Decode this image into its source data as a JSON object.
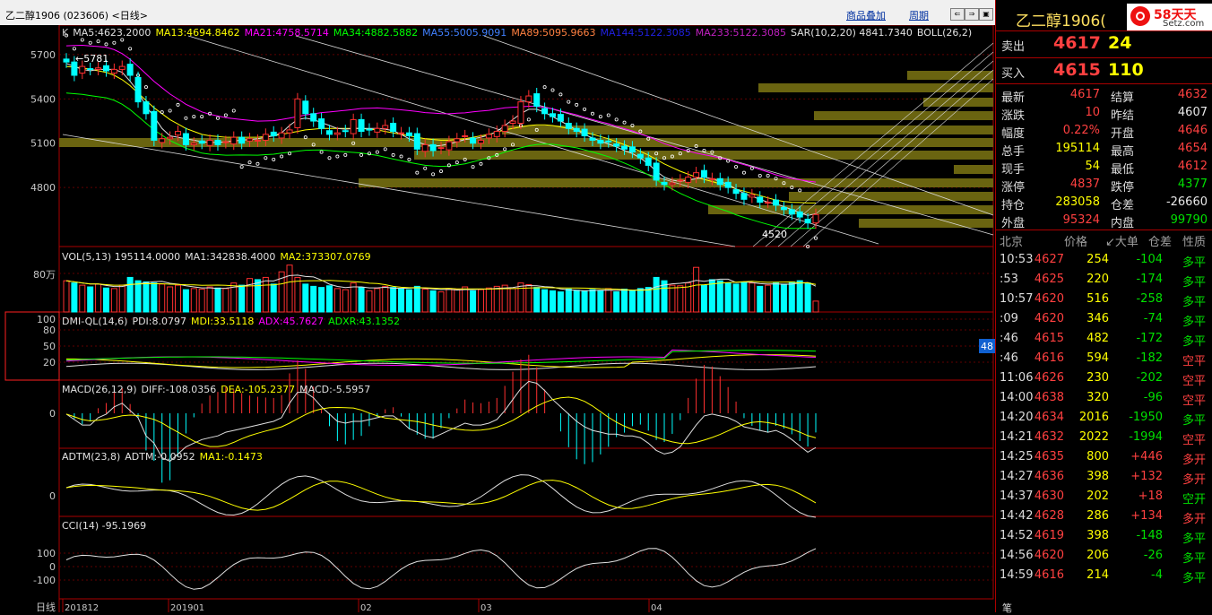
{
  "topbar": {
    "title": "乙二醇1906 (023606) <日线>",
    "overlay_link": "商品叠加",
    "period_link": "周期"
  },
  "k_panel": {
    "indicators": [
      {
        "text": "K",
        "color": "#c8c8c8"
      },
      {
        "text": "MA5:4623.2000",
        "color": "#e0e0e0"
      },
      {
        "text": "MA13:4694.8462",
        "color": "#ffff00"
      },
      {
        "text": "MA21:4758.5714",
        "color": "#ff00ff"
      },
      {
        "text": "MA34:4882.5882",
        "color": "#00ff00"
      },
      {
        "text": "MA55:5005.9091",
        "color": "#4080ff"
      },
      {
        "text": "MA89:5095.9663",
        "color": "#ff8040"
      },
      {
        "text": "MA144:5122.3085",
        "color": "#2020e0"
      },
      {
        "text": "MA233:5122.3085",
        "color": "#c020c0"
      },
      {
        "text": "SAR(10,2,20)  4841.7340",
        "color": "#e0e0e0"
      },
      {
        "text": "BOLL(26,2)",
        "color": "#e0e0e0"
      }
    ],
    "axis_labels": [
      "5700",
      "5400",
      "5100",
      "4800"
    ],
    "high_mark": "5781",
    "low_mark": "4520"
  },
  "vol_panel": {
    "indicators": [
      {
        "text": "VOL(5,13)  195114.0000",
        "color": "#e0e0e0"
      },
      {
        "text": "MA1:342838.4000",
        "color": "#e0e0e0"
      },
      {
        "text": "MA2:373307.0769",
        "color": "#ffff00"
      }
    ],
    "axis_label": "80万"
  },
  "dmi_panel": {
    "indicators": [
      {
        "text": "DMI-QL(14,6)",
        "color": "#e0e0e0"
      },
      {
        "text": "PDI:8.0797",
        "color": "#e0e0e0"
      },
      {
        "text": "MDI:33.5118",
        "color": "#ffff00"
      },
      {
        "text": "ADX:45.7627",
        "color": "#ff00ff"
      },
      {
        "text": "ADXR:43.1352",
        "color": "#00ff00"
      }
    ],
    "axis_labels": [
      "100",
      "80",
      "50",
      "20"
    ],
    "badge": "48"
  },
  "macd_panel": {
    "indicators": [
      {
        "text": "MACD(26,12,9)",
        "color": "#e0e0e0"
      },
      {
        "text": "DIFF:-108.0356",
        "color": "#e0e0e0"
      },
      {
        "text": "DEA:-105.2377",
        "color": "#ffff00"
      },
      {
        "text": "MACD:-5.5957",
        "color": "#e0e0e0"
      }
    ],
    "axis_label": "0"
  },
  "adtm_panel": {
    "indicators": [
      {
        "text": "ADTM(23,8)",
        "color": "#e0e0e0"
      },
      {
        "text": "ADTM:-0.0952",
        "color": "#e0e0e0"
      },
      {
        "text": "MA1:-0.1473",
        "color": "#ffff00"
      }
    ],
    "axis_label": "0"
  },
  "cci_panel": {
    "indicators": [
      {
        "text": "CCI(14)  -95.1969",
        "color": "#e0e0e0"
      }
    ],
    "axis_labels": [
      "100",
      "0",
      "-100"
    ]
  },
  "date_axis": {
    "period": "日线",
    "labels": [
      "201812",
      "201901",
      "02",
      "03",
      "04"
    ]
  },
  "chart_data": {
    "type": "candlestick",
    "xlabel": "",
    "ylabel": "",
    "ylim": [
      4400,
      5900
    ],
    "x_labels": [
      "201812",
      "201901",
      "02",
      "03",
      "04"
    ],
    "close": [
      5650,
      5560,
      5620,
      5600,
      5610,
      5590,
      5600,
      5620,
      5560,
      5380,
      5300,
      5120,
      5130,
      5140,
      5180,
      5090,
      5100,
      5100,
      5120,
      5090,
      5110,
      5140,
      5100,
      5130,
      5120,
      5160,
      5150,
      5170,
      5190,
      5400,
      5300,
      5250,
      5200,
      5160,
      5170,
      5180,
      5260,
      5180,
      5190,
      5200,
      5220,
      5180,
      5170,
      5150,
      5060,
      5090,
      5050,
      5070,
      5110,
      5130,
      5150,
      5100,
      5120,
      5160,
      5180,
      5220,
      5250,
      5380,
      5420,
      5350,
      5300,
      5280,
      5250,
      5200,
      5180,
      5150,
      5120,
      5100,
      5110,
      5080,
      5060,
      5040,
      5000,
      4950,
      4850,
      4820,
      4830,
      4850,
      4870,
      4900,
      4870,
      4860,
      4820,
      4800,
      4760,
      4720,
      4750,
      4700,
      4700,
      4680,
      4650,
      4620,
      4600,
      4560,
      4617
    ],
    "ma5": [
      5640,
      5620,
      5600,
      5590,
      5600,
      5600,
      5600,
      5580,
      5520,
      5450,
      5350,
      5280,
      5200,
      5150,
      5140,
      5130,
      5120,
      5110,
      5105,
      5105,
      5110,
      5115,
      5120,
      5125,
      5130,
      5140,
      5150,
      5170,
      5220,
      5260,
      5270,
      5260,
      5240,
      5220,
      5200,
      5195,
      5200,
      5200,
      5200,
      5200,
      5195,
      5185,
      5160,
      5130,
      5110,
      5090,
      5080,
      5085,
      5095,
      5110,
      5125,
      5130,
      5140,
      5155,
      5180,
      5220,
      5260,
      5300,
      5330,
      5330,
      5310,
      5280,
      5250,
      5220,
      5190,
      5160,
      5135,
      5115,
      5095,
      5075,
      5050,
      5030,
      5000,
      4960,
      4910,
      4870,
      4850,
      4840,
      4850,
      4860,
      4870,
      4860,
      4840,
      4820,
      4790,
      4760,
      4740,
      4720,
      4700,
      4690,
      4670,
      4650,
      4630,
      4610,
      4623
    ],
    "ma13": [
      5620,
      5615,
      5610,
      5600,
      5590,
      5580,
      5560,
      5530,
      5490,
      5440,
      5390,
      5340,
      5300,
      5260,
      5230,
      5200,
      5180,
      5160,
      5150,
      5145,
      5140,
      5140,
      5140,
      5140,
      5140,
      5145,
      5150,
      5160,
      5170,
      5180,
      5190,
      5195,
      5200,
      5200,
      5200,
      5200,
      5200,
      5200,
      5195,
      5190,
      5180,
      5170,
      5160,
      5150,
      5140,
      5130,
      5125,
      5120,
      5120,
      5125,
      5130,
      5140,
      5150,
      5160,
      5175,
      5190,
      5200,
      5210,
      5220,
      5225,
      5225,
      5220,
      5210,
      5200,
      5190,
      5175,
      5160,
      5145,
      5130,
      5110,
      5090,
      5070,
      5045,
      5020,
      4990,
      4960,
      4935,
      4910,
      4890,
      4870,
      4855,
      4840,
      4825,
      4810,
      4790,
      4775,
      4760,
      4745,
      4730,
      4715,
      4705,
      4700,
      4698,
      4695,
      4695
    ],
    "vol": [
      560,
      520,
      480,
      450,
      500,
      430,
      420,
      480,
      620,
      560,
      540,
      520,
      500,
      450,
      480,
      400,
      420,
      410,
      450,
      430,
      420,
      520,
      480,
      600,
      580,
      620,
      500,
      720,
      840,
      620,
      500,
      460,
      440,
      470,
      420,
      400,
      520,
      440,
      380,
      420,
      460,
      440,
      420,
      400,
      460,
      410,
      380,
      360,
      420,
      400,
      450,
      380,
      400,
      430,
      460,
      480,
      420,
      520,
      490,
      440,
      400,
      380,
      360,
      410,
      390,
      370,
      400,
      380,
      420,
      360,
      410,
      380,
      420,
      440,
      620,
      560,
      480,
      470,
      520,
      800,
      480,
      580,
      560,
      520,
      500,
      540,
      520,
      460,
      480,
      520,
      500,
      540,
      560,
      520,
      195
    ]
  },
  "right": {
    "symbol": "乙二醇1906(",
    "logo_main": "58天天",
    "logo_sub": "Setz.com",
    "sell": {
      "label": "卖出",
      "price": "4617",
      "vol": "24"
    },
    "buy": {
      "label": "买入",
      "price": "4615",
      "vol": "110"
    },
    "quotes": [
      {
        "l1": "最新",
        "v1": "4617",
        "c1": "red",
        "l2": "结算",
        "v2": "4632",
        "c2": "red"
      },
      {
        "l1": "涨跌",
        "v1": "10",
        "c1": "red",
        "l2": "昨结",
        "v2": "4607",
        "c2": "wht"
      },
      {
        "l1": "幅度",
        "v1": "0.22%",
        "c1": "red",
        "l2": "开盘",
        "v2": "4646",
        "c2": "red"
      },
      {
        "l1": "总手",
        "v1": "195114",
        "c1": "yel",
        "l2": "最高",
        "v2": "4654",
        "c2": "red"
      },
      {
        "l1": "现手",
        "v1": "54",
        "c1": "yel",
        "l2": "最低",
        "v2": "4612",
        "c2": "red"
      },
      {
        "l1": "涨停",
        "v1": "4837",
        "c1": "red",
        "l2": "跌停",
        "v2": "4377",
        "c2": "grn"
      },
      {
        "l1": "持仓",
        "v1": "283058",
        "c1": "yel",
        "l2": "仓差",
        "v2": "-26660",
        "c2": "wht"
      },
      {
        "l1": "外盘",
        "v1": "95324",
        "c1": "red",
        "l2": "内盘",
        "v2": "99790",
        "c2": "grn"
      }
    ],
    "tick_header": {
      "place": "北京",
      "price": "价格",
      "vol": "↙大单",
      "chg": "仓差",
      "nature": "性质"
    },
    "ticks": [
      {
        "t": "10:53",
        "p": "4627",
        "v": "254",
        "c": "-104",
        "n": "多平",
        "cc": "grn",
        "nc": "grn"
      },
      {
        "t": ":53",
        "p": "4625",
        "v": "220",
        "c": "-174",
        "n": "多平",
        "cc": "grn",
        "nc": "grn"
      },
      {
        "t": "10:57",
        "p": "4620",
        "v": "516",
        "c": "-258",
        "n": "多平",
        "cc": "grn",
        "nc": "grn"
      },
      {
        "t": ":09",
        "p": "4620",
        "v": "346",
        "c": "-74",
        "n": "多平",
        "cc": "grn",
        "nc": "grn"
      },
      {
        "t": ":46",
        "p": "4615",
        "v": "482",
        "c": "-172",
        "n": "多平",
        "cc": "grn",
        "nc": "grn"
      },
      {
        "t": ":46",
        "p": "4616",
        "v": "594",
        "c": "-182",
        "n": "空平",
        "cc": "grn",
        "nc": "red"
      },
      {
        "t": "11:06",
        "p": "4626",
        "v": "230",
        "c": "-202",
        "n": "空平",
        "cc": "grn",
        "nc": "red"
      },
      {
        "t": "14:00",
        "p": "4638",
        "v": "320",
        "c": "-96",
        "n": "空平",
        "cc": "grn",
        "nc": "red"
      },
      {
        "t": "14:20",
        "p": "4634",
        "v": "2016",
        "c": "-1950",
        "n": "多平",
        "cc": "grn",
        "nc": "grn"
      },
      {
        "t": "14:21",
        "p": "4632",
        "v": "2022",
        "c": "-1994",
        "n": "空平",
        "cc": "grn",
        "nc": "red"
      },
      {
        "t": "14:25",
        "p": "4635",
        "v": "800",
        "c": "+446",
        "n": "多开",
        "cc": "red",
        "nc": "red"
      },
      {
        "t": "14:27",
        "p": "4636",
        "v": "398",
        "c": "+132",
        "n": "多开",
        "cc": "red",
        "nc": "red"
      },
      {
        "t": "14:37",
        "p": "4630",
        "v": "202",
        "c": "+18",
        "n": "空开",
        "cc": "red",
        "nc": "grn"
      },
      {
        "t": "14:42",
        "p": "4628",
        "v": "286",
        "c": "+134",
        "n": "多开",
        "cc": "red",
        "nc": "red"
      },
      {
        "t": "14:52",
        "p": "4619",
        "v": "398",
        "c": "-148",
        "n": "多平",
        "cc": "grn",
        "nc": "grn"
      },
      {
        "t": "14:56",
        "p": "4620",
        "v": "206",
        "c": "-26",
        "n": "多平",
        "cc": "grn",
        "nc": "grn"
      },
      {
        "t": "14:59",
        "p": "4616",
        "v": "214",
        "c": "-4",
        "n": "多平",
        "cc": "grn",
        "nc": "grn"
      }
    ],
    "bottom_tab": "笔"
  }
}
